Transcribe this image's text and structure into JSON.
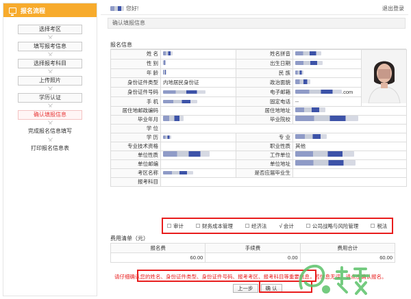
{
  "sidebar": {
    "title": "报名流程",
    "steps": [
      {
        "label": "选择考区",
        "active": false,
        "boxed": true
      },
      {
        "label": "填写报考信息",
        "active": false,
        "boxed": true
      },
      {
        "label": "选择报考科目",
        "active": false,
        "boxed": true
      },
      {
        "label": "上传照片",
        "active": false,
        "boxed": true
      },
      {
        "label": "学历认证",
        "active": false,
        "boxed": true
      },
      {
        "label": "确认填报信息",
        "active": true,
        "boxed": true
      },
      {
        "label": "完成报名信息填写",
        "active": false,
        "boxed": false
      },
      {
        "label": "打印报名信息表",
        "active": false,
        "boxed": false
      }
    ]
  },
  "header": {
    "greeting": "您好!",
    "logout": "退出登录"
  },
  "section_title": "确认填报信息",
  "info": {
    "title": "报名信息",
    "labels": {
      "name": "姓 名",
      "pinyin": "姓名拼音",
      "gender": "性 别",
      "birth": "出生日期",
      "age": "年 龄",
      "ethnic": "民 族",
      "id_type": "身份证件类型",
      "political": "政治面貌",
      "id_no": "身份证件号码",
      "email": "电子邮箱",
      "mobile": "手 机",
      "phone": "固定电话",
      "zip": "居住地邮政编码",
      "address": "居住地地址",
      "grad_date": "毕业年月",
      "school": "毕业院校",
      "degree": "学 位",
      "education": "学 历",
      "major": "专 业",
      "title_qual": "专业技术资格",
      "job_nature": "职业性质",
      "unit_nature": "单位性质",
      "work_unit": "工作单位",
      "unit_zip": "单位邮编",
      "unit_address": "单位地址",
      "exam_area": "考区名称",
      "fresh_grad": "是否应届毕业生",
      "subjects": "报考科目"
    },
    "values": {
      "id_type": "内地居民身份证",
      "email_suffix": ".com",
      "phone": "--",
      "job_nature": "其他"
    }
  },
  "subjects": [
    {
      "label": "审计",
      "checked": false
    },
    {
      "label": "财务成本管理",
      "checked": false
    },
    {
      "label": "经济法",
      "checked": false
    },
    {
      "label": "会计",
      "checked": true
    },
    {
      "label": "公司战略与风险管理",
      "checked": false
    },
    {
      "label": "税法",
      "checked": false
    }
  ],
  "fees": {
    "title": "费用清单（元）",
    "headers": [
      "报名费",
      "手续费",
      "费用合计"
    ],
    "values": [
      "60.00",
      "0.00",
      "60.00"
    ]
  },
  "notice": "请仔细确认您的姓名、身份证件类型、身份证件号码、报考考区、报考科目等重要信息，若信息无误，请点击确认报名。",
  "buttons": {
    "prev": "上一步",
    "confirm": "确 认"
  },
  "colors": {
    "accent": "#f7ab2c",
    "highlight": "#e81c1c",
    "active_step": "#e83a3a"
  }
}
